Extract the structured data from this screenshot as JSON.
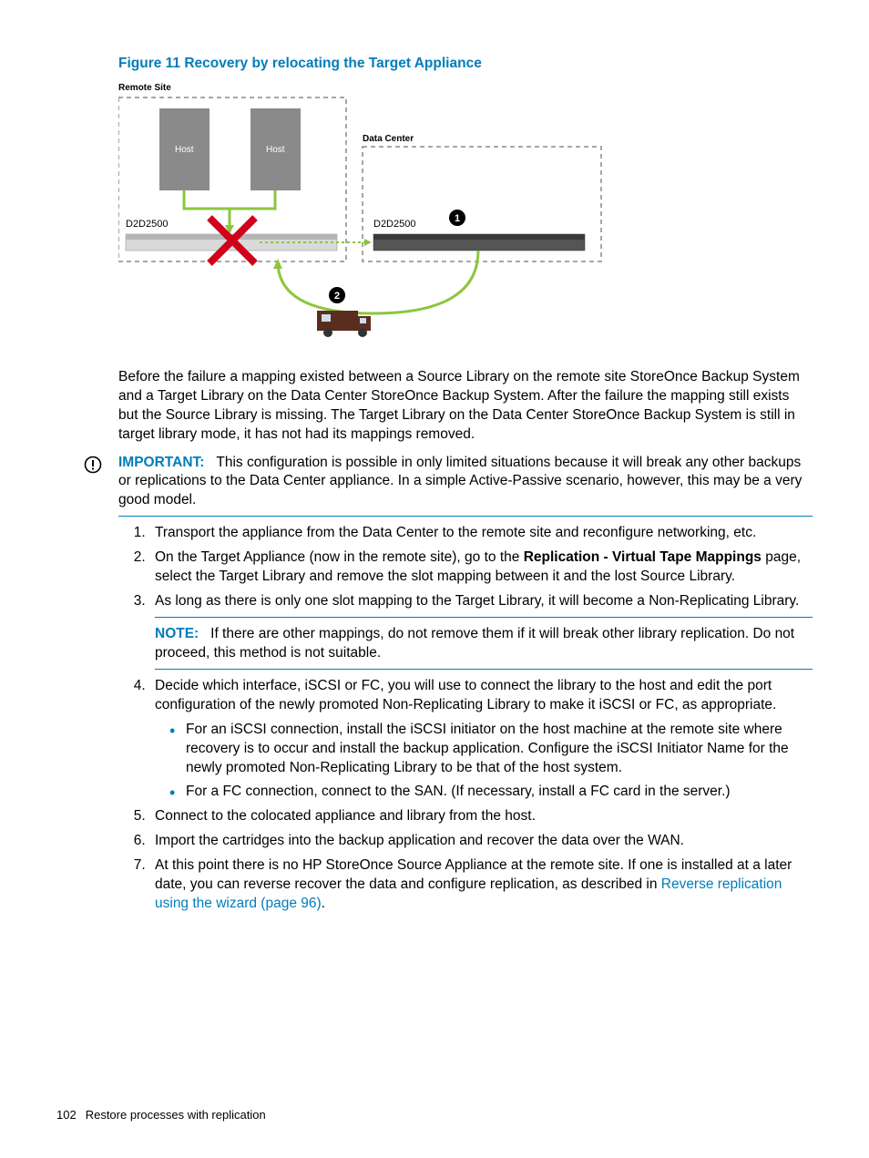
{
  "figure": {
    "title": "Figure 11 Recovery by relocating the Target Appliance",
    "labels": {
      "remote_site": "Remote Site",
      "data_center": "Data Center",
      "host": "Host",
      "d2d_left": "D2D2500",
      "d2d_right": "D2D2500"
    }
  },
  "paragraph_intro": "Before the failure a mapping existed between a Source Library on the remote site StoreOnce Backup System and a Target Library on the Data Center StoreOnce Backup System. After the failure the mapping still exists but the Source Library is missing. The Target Library on the Data Center StoreOnce Backup System is still in target library mode, it has not had its mappings removed.",
  "important": {
    "label": "IMPORTANT:",
    "text": "This configuration is possible in only limited situations because it will break any other backups or replications to the Data Center appliance. In a simple Active-Passive scenario, however, this may be a very good model."
  },
  "steps": {
    "s1": "Transport the appliance from the Data Center to the remote site and reconfigure networking, etc.",
    "s2_pre": "On the Target Appliance (now in the remote site), go to the ",
    "s2_bold": "Replication - Virtual Tape Mappings",
    "s2_post": " page, select the Target Library and remove the slot mapping between it and the lost Source Library.",
    "s3": "As long as there is only one slot mapping to the Target Library, it will become a Non-Replicating Library.",
    "note_label": "NOTE:",
    "note_text": "If there are other mappings, do not remove them if it will break other library replication. Do not proceed, this method is not suitable.",
    "s4": "Decide which interface, iSCSI or FC, you will use to connect the library to the host and edit the port configuration of the newly promoted Non-Replicating Library to make it iSCSI or FC, as appropriate.",
    "s4_b1": "For an iSCSI connection, install the iSCSI initiator on the host machine at the remote site where recovery is to occur and install the backup application. Configure the iSCSI Initiator Name for the newly promoted Non-Replicating Library to be that of the host system.",
    "s4_b2": "For a FC connection, connect to the SAN. (If necessary, install a FC card in the server.)",
    "s5": "Connect to the colocated appliance and library from the host.",
    "s6": "Import the cartridges into the backup application and recover the data over the WAN.",
    "s7_pre": "At this point there is no HP StoreOnce Source Appliance at the remote site. If one is installed at a later date, you can reverse recover the data and configure replication, as described in ",
    "s7_link": "Reverse replication using the wizard (page 96)",
    "s7_post": "."
  },
  "footer": {
    "page": "102",
    "section": "Restore processes with replication"
  }
}
